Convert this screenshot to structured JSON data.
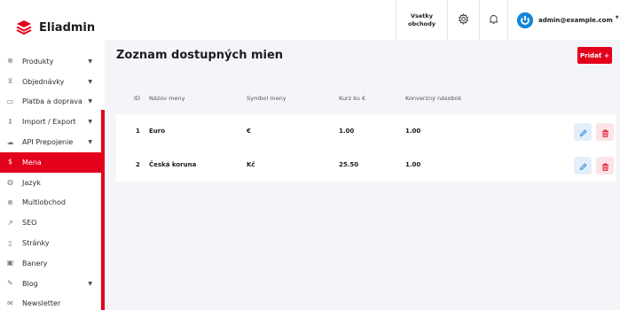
{
  "app": {
    "name": "Eliadmin"
  },
  "colors": {
    "brand": "#e3001b",
    "accent": "#1684d9"
  },
  "sidebar": {
    "items": [
      {
        "label": "Produkty",
        "icon": "box-icon",
        "caret": true
      },
      {
        "label": "Objednávky",
        "icon": "cart-icon",
        "caret": true
      },
      {
        "label": "Platba a doprava",
        "icon": "card-icon",
        "caret": true
      },
      {
        "label": "Import / Export",
        "icon": "sort-icon",
        "caret": true
      },
      {
        "label": "API Prepojenie",
        "icon": "cloud-icon",
        "caret": true
      },
      {
        "label": "Mena",
        "icon": "dollar-icon",
        "caret": false,
        "active": true
      },
      {
        "label": "Jazyk",
        "icon": "globe-icon",
        "caret": false
      },
      {
        "label": "Multiobchod",
        "icon": "globe-grid-icon",
        "caret": false
      },
      {
        "label": "SEO",
        "icon": "trend-icon",
        "caret": false
      },
      {
        "label": "Stránky",
        "icon": "page-icon",
        "caret": false
      },
      {
        "label": "Banery",
        "icon": "image-icon",
        "caret": false
      },
      {
        "label": "Blog",
        "icon": "pencil-icon",
        "caret": true
      },
      {
        "label": "Newsletter",
        "icon": "mail-icon",
        "caret": false
      }
    ]
  },
  "header": {
    "shop_label": "Vsetky\nobchody",
    "user_email": "admin@example.com"
  },
  "main": {
    "title": "Zoznam dostupných mien",
    "add_label": "Pridať",
    "add_icon": "plus-icon",
    "columns": [
      "ID",
      "Názov meny",
      "Symbol meny",
      "Kurz ku €",
      "Konverzný násobok"
    ],
    "rows": [
      {
        "id": "1",
        "name": "Euro",
        "symbol": "€",
        "rate": "1.00",
        "multiplier": "1.00"
      },
      {
        "id": "2",
        "name": "Česká koruna",
        "symbol": "Kč",
        "rate": "25.50",
        "multiplier": "1.00"
      }
    ]
  }
}
